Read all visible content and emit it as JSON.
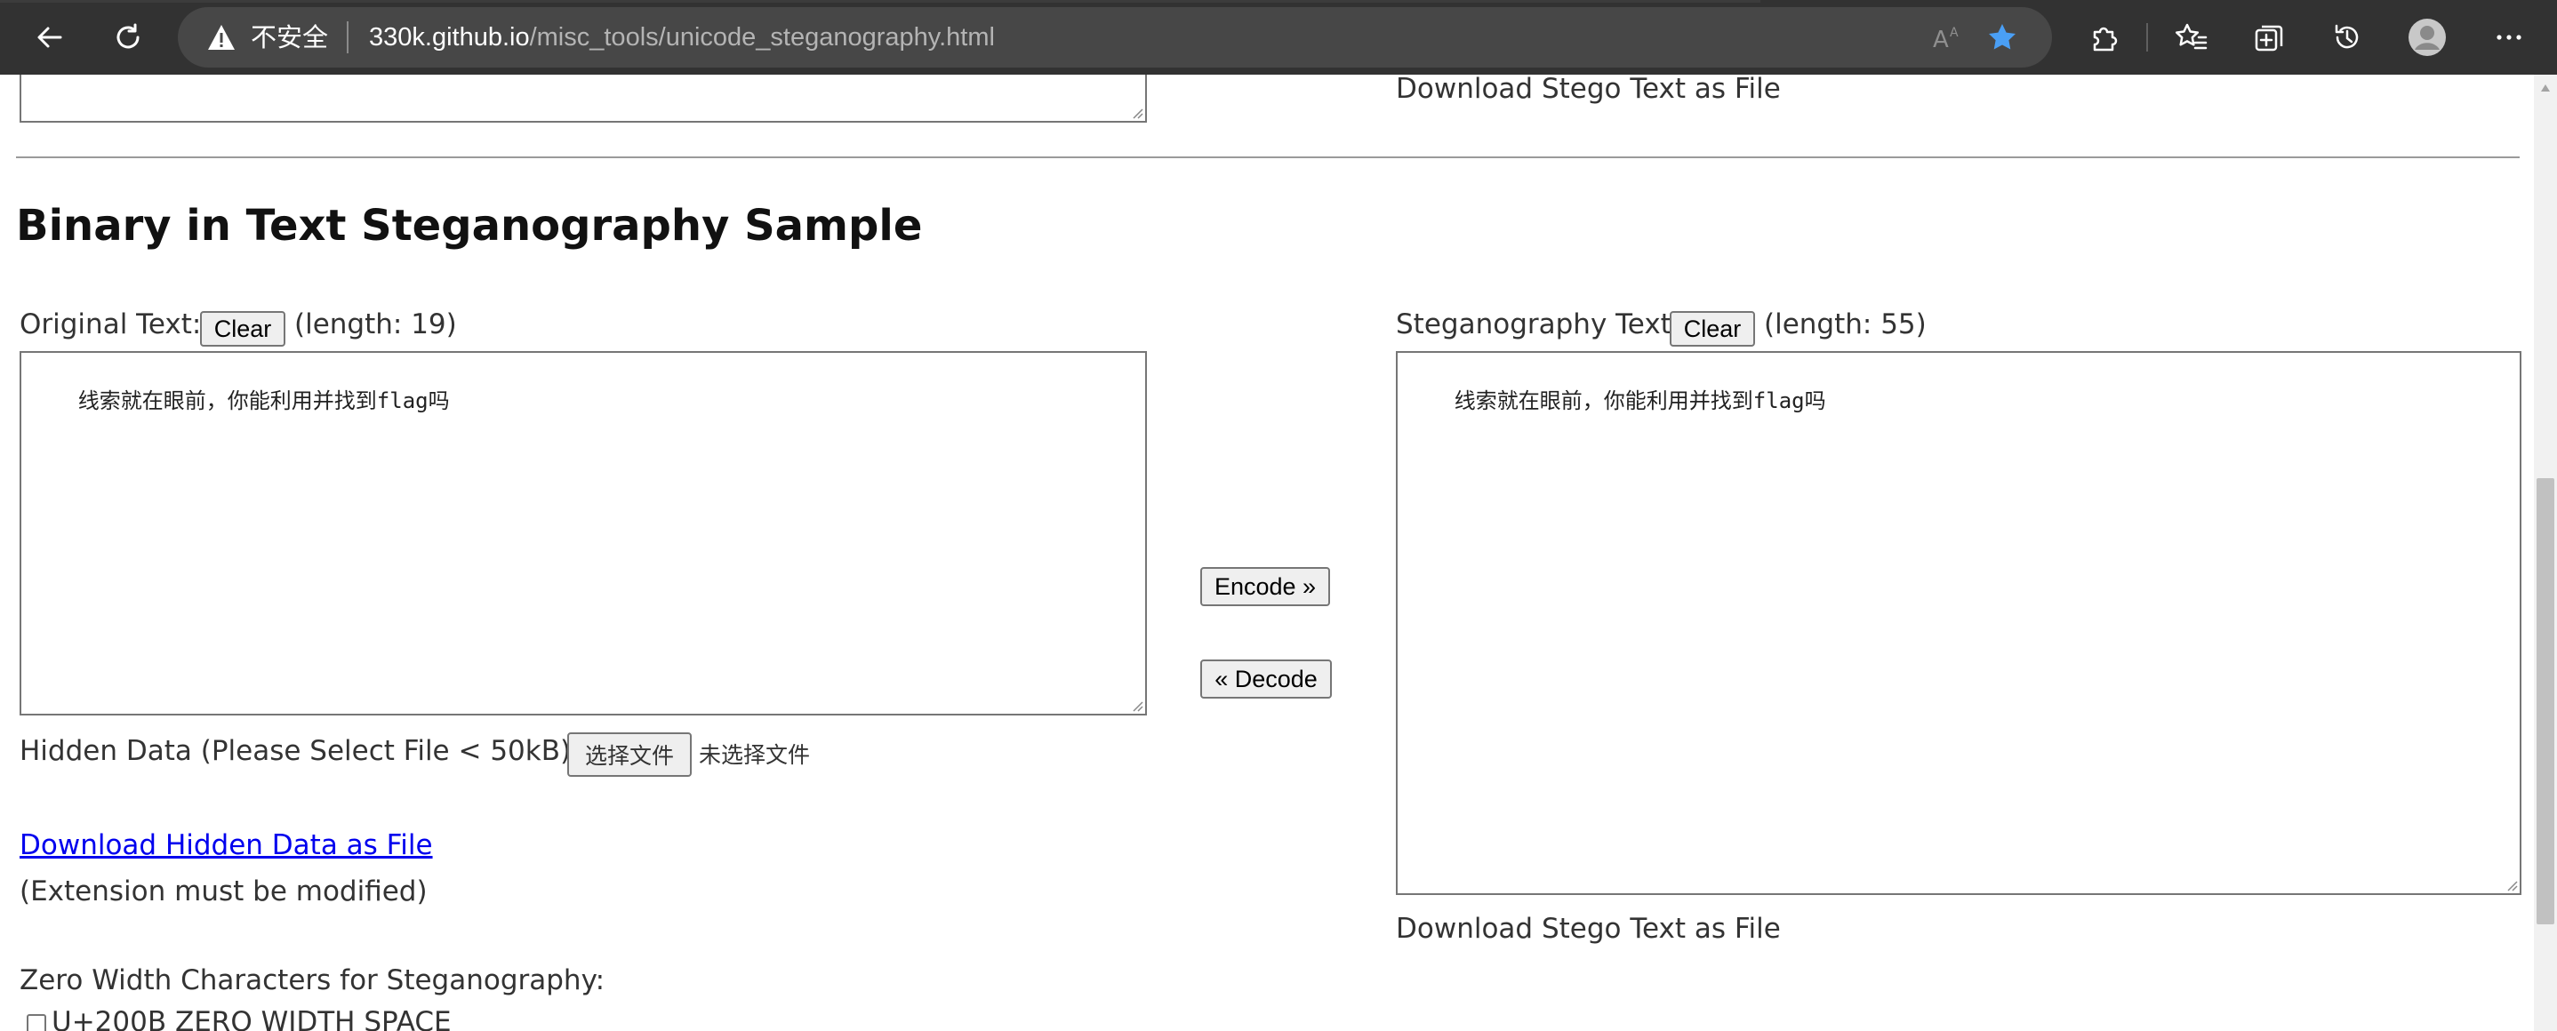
{
  "browser": {
    "security_label": "不安全",
    "url_host": "330k.github.io",
    "url_path": "/misc_tools/unicode_steganography.html",
    "icons": [
      "back-icon",
      "refresh-icon",
      "warning-icon",
      "read-aloud-icon",
      "favorite-star-icon",
      "extensions-icon",
      "favorites-icon",
      "collections-icon",
      "history-icon",
      "profile-icon",
      "more-icon"
    ],
    "accent_color": "#4a9ff5"
  },
  "top_section": {
    "download_stego_label": "Download Stego Text as File"
  },
  "section": {
    "title": "Binary in Text Steganography Sample"
  },
  "original": {
    "label": "Original Text:",
    "clear_label": "Clear",
    "length_text": "(length: 19)",
    "text": "线索就在眼前，你能利用并找到flag吗"
  },
  "stego": {
    "label": "Steganography Text:",
    "clear_label": "Clear",
    "length_text": "(length: 55)",
    "text": "线索就在眼前，你能利用并找到flag吗",
    "download_label": "Download Stego Text as File"
  },
  "actions": {
    "encode_label": "Encode »",
    "decode_label": "« Decode"
  },
  "hidden_data": {
    "label": "Hidden Data (Please Select File < 50kB):",
    "choose_file_label": "选择文件",
    "no_file_text": "未选择文件",
    "download_link": "Download Hidden Data as File",
    "note": "(Extension must be modified)"
  },
  "zero_width": {
    "label": "Zero Width Characters for Steganography:",
    "first_option": "U+200B ZERO WIDTH SPACE"
  }
}
